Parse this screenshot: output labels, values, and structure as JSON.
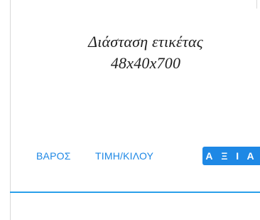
{
  "label_info": {
    "line1": "Διάσταση ετικέτας",
    "line2": "48x40x700"
  },
  "tabs": [
    {
      "label": "ΒΑΡΟΣ",
      "active": false
    },
    {
      "label": "ΤΙΜΗ/ΚΙΛΟΥ",
      "active": false
    },
    {
      "label": "Α Ξ Ι Α",
      "active": true
    }
  ],
  "colors": {
    "accent": "#1e88e5",
    "underline": "#2aa0ea",
    "frame": "#d9d9d9",
    "text": "#1f1f1f"
  }
}
